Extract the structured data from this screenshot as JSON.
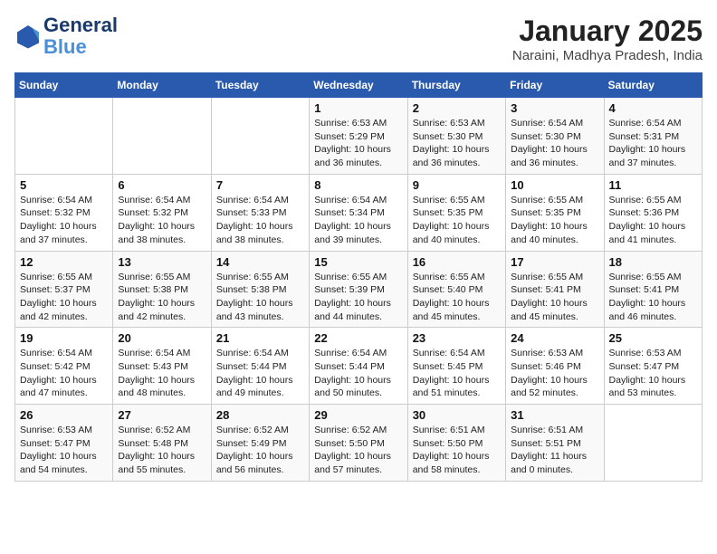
{
  "header": {
    "logo_line1": "General",
    "logo_line2": "Blue",
    "month_title": "January 2025",
    "location": "Naraini, Madhya Pradesh, India"
  },
  "weekdays": [
    "Sunday",
    "Monday",
    "Tuesday",
    "Wednesday",
    "Thursday",
    "Friday",
    "Saturday"
  ],
  "weeks": [
    [
      {
        "num": "",
        "info": ""
      },
      {
        "num": "",
        "info": ""
      },
      {
        "num": "",
        "info": ""
      },
      {
        "num": "1",
        "info": "Sunrise: 6:53 AM\nSunset: 5:29 PM\nDaylight: 10 hours and 36 minutes."
      },
      {
        "num": "2",
        "info": "Sunrise: 6:53 AM\nSunset: 5:30 PM\nDaylight: 10 hours and 36 minutes."
      },
      {
        "num": "3",
        "info": "Sunrise: 6:54 AM\nSunset: 5:30 PM\nDaylight: 10 hours and 36 minutes."
      },
      {
        "num": "4",
        "info": "Sunrise: 6:54 AM\nSunset: 5:31 PM\nDaylight: 10 hours and 37 minutes."
      }
    ],
    [
      {
        "num": "5",
        "info": "Sunrise: 6:54 AM\nSunset: 5:32 PM\nDaylight: 10 hours and 37 minutes."
      },
      {
        "num": "6",
        "info": "Sunrise: 6:54 AM\nSunset: 5:32 PM\nDaylight: 10 hours and 38 minutes."
      },
      {
        "num": "7",
        "info": "Sunrise: 6:54 AM\nSunset: 5:33 PM\nDaylight: 10 hours and 38 minutes."
      },
      {
        "num": "8",
        "info": "Sunrise: 6:54 AM\nSunset: 5:34 PM\nDaylight: 10 hours and 39 minutes."
      },
      {
        "num": "9",
        "info": "Sunrise: 6:55 AM\nSunset: 5:35 PM\nDaylight: 10 hours and 40 minutes."
      },
      {
        "num": "10",
        "info": "Sunrise: 6:55 AM\nSunset: 5:35 PM\nDaylight: 10 hours and 40 minutes."
      },
      {
        "num": "11",
        "info": "Sunrise: 6:55 AM\nSunset: 5:36 PM\nDaylight: 10 hours and 41 minutes."
      }
    ],
    [
      {
        "num": "12",
        "info": "Sunrise: 6:55 AM\nSunset: 5:37 PM\nDaylight: 10 hours and 42 minutes."
      },
      {
        "num": "13",
        "info": "Sunrise: 6:55 AM\nSunset: 5:38 PM\nDaylight: 10 hours and 42 minutes."
      },
      {
        "num": "14",
        "info": "Sunrise: 6:55 AM\nSunset: 5:38 PM\nDaylight: 10 hours and 43 minutes."
      },
      {
        "num": "15",
        "info": "Sunrise: 6:55 AM\nSunset: 5:39 PM\nDaylight: 10 hours and 44 minutes."
      },
      {
        "num": "16",
        "info": "Sunrise: 6:55 AM\nSunset: 5:40 PM\nDaylight: 10 hours and 45 minutes."
      },
      {
        "num": "17",
        "info": "Sunrise: 6:55 AM\nSunset: 5:41 PM\nDaylight: 10 hours and 45 minutes."
      },
      {
        "num": "18",
        "info": "Sunrise: 6:55 AM\nSunset: 5:41 PM\nDaylight: 10 hours and 46 minutes."
      }
    ],
    [
      {
        "num": "19",
        "info": "Sunrise: 6:54 AM\nSunset: 5:42 PM\nDaylight: 10 hours and 47 minutes."
      },
      {
        "num": "20",
        "info": "Sunrise: 6:54 AM\nSunset: 5:43 PM\nDaylight: 10 hours and 48 minutes."
      },
      {
        "num": "21",
        "info": "Sunrise: 6:54 AM\nSunset: 5:44 PM\nDaylight: 10 hours and 49 minutes."
      },
      {
        "num": "22",
        "info": "Sunrise: 6:54 AM\nSunset: 5:44 PM\nDaylight: 10 hours and 50 minutes."
      },
      {
        "num": "23",
        "info": "Sunrise: 6:54 AM\nSunset: 5:45 PM\nDaylight: 10 hours and 51 minutes."
      },
      {
        "num": "24",
        "info": "Sunrise: 6:53 AM\nSunset: 5:46 PM\nDaylight: 10 hours and 52 minutes."
      },
      {
        "num": "25",
        "info": "Sunrise: 6:53 AM\nSunset: 5:47 PM\nDaylight: 10 hours and 53 minutes."
      }
    ],
    [
      {
        "num": "26",
        "info": "Sunrise: 6:53 AM\nSunset: 5:47 PM\nDaylight: 10 hours and 54 minutes."
      },
      {
        "num": "27",
        "info": "Sunrise: 6:52 AM\nSunset: 5:48 PM\nDaylight: 10 hours and 55 minutes."
      },
      {
        "num": "28",
        "info": "Sunrise: 6:52 AM\nSunset: 5:49 PM\nDaylight: 10 hours and 56 minutes."
      },
      {
        "num": "29",
        "info": "Sunrise: 6:52 AM\nSunset: 5:50 PM\nDaylight: 10 hours and 57 minutes."
      },
      {
        "num": "30",
        "info": "Sunrise: 6:51 AM\nSunset: 5:50 PM\nDaylight: 10 hours and 58 minutes."
      },
      {
        "num": "31",
        "info": "Sunrise: 6:51 AM\nSunset: 5:51 PM\nDaylight: 11 hours and 0 minutes."
      },
      {
        "num": "",
        "info": ""
      }
    ]
  ]
}
